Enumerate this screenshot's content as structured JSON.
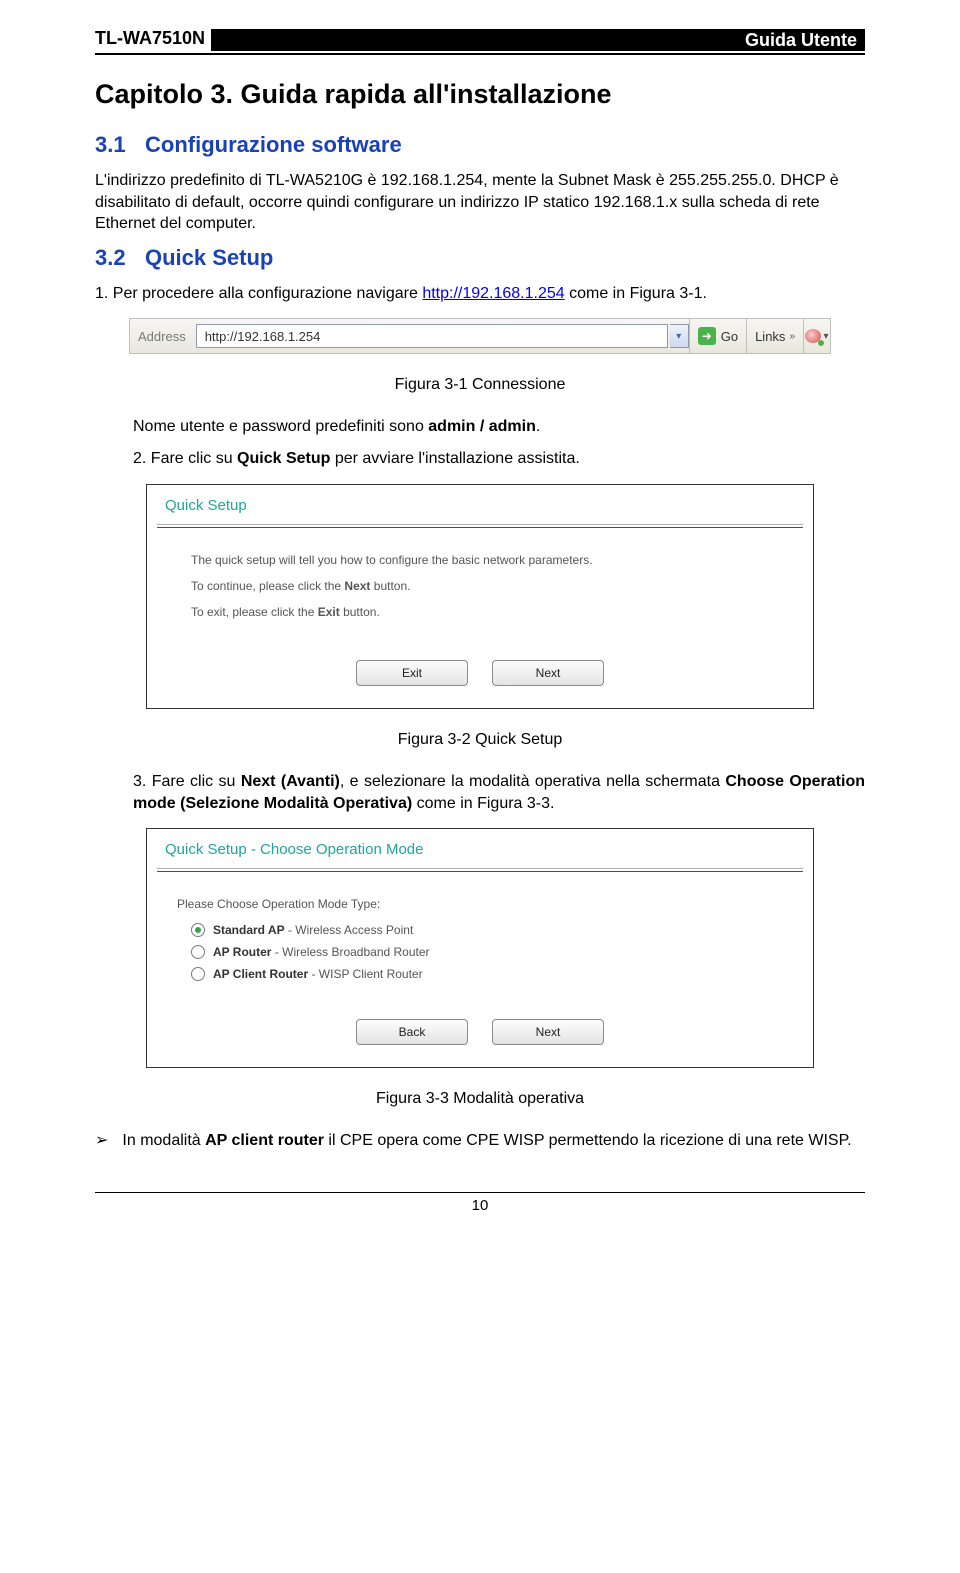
{
  "header": {
    "model": "TL-WA7510N",
    "doc_type": "Guida Utente"
  },
  "chapter": {
    "title": "Capitolo 3. Guida rapida all'installazione"
  },
  "section31": {
    "num": "3.1",
    "title": "Configurazione software",
    "para1": "L'indirizzo predefinito di TL-WA5210G è 192.168.1.254, mente la Subnet Mask è 255.255.255.0. DHCP è disabilitato di default, occorre quindi configurare un indirizzo IP statico 192.168.1.x sulla scheda di rete Ethernet del computer."
  },
  "section32": {
    "num": "3.2",
    "title": "Quick Setup",
    "step1_prefix": "1. Per procedere alla configurazione navigare ",
    "step1_link": "http://192.168.1.254",
    "step1_suffix": " come in Figura 3-1.",
    "fig1_caption": "Figura 3-1 Connessione",
    "cred_prefix": "Nome utente e password predefiniti sono ",
    "cred_value": "admin / admin",
    "cred_suffix": ".",
    "step2_prefix": "2. Fare clic su ",
    "step2_bold": "Quick Setup",
    "step2_suffix": " per avviare l'installazione assistita.",
    "fig2_caption": "Figura 3-2 Quick Setup",
    "step3_a": "3. Fare clic su ",
    "step3_b": "Next (Avanti)",
    "step3_c": ", e selezionare la modalità operativa nella schermata ",
    "step3_d": "Choose Operation mode (Selezione Modalità Operativa)",
    "step3_e": " come in Figura 3-3.",
    "fig3_caption": "Figura 3-3 Modalità operativa",
    "footer_a": "In modalità ",
    "footer_b": "AP client router",
    "footer_c": " il CPE opera come CPE WISP permettendo la ricezione di una rete WISP."
  },
  "addressbar": {
    "label": "Address",
    "url": "http://192.168.1.254",
    "go": "Go",
    "links": "Links"
  },
  "panel_qs": {
    "title": "Quick Setup",
    "line1": "The quick setup will tell you how to configure the basic network parameters.",
    "line2a": "To continue, please click the ",
    "line2b": "Next",
    "line2c": " button.",
    "line3a": "To exit, please click the ",
    "line3b": "Exit",
    "line3c": " button.",
    "btn_exit": "Exit",
    "btn_next": "Next"
  },
  "panel_mode": {
    "title": "Quick Setup - Choose Operation Mode",
    "prompt": "Please Choose Operation Mode Type:",
    "modes": [
      {
        "name": "Standard AP",
        "desc": " - Wireless Access Point",
        "checked": true
      },
      {
        "name": "AP Router",
        "desc": " - Wireless Broadband Router",
        "checked": false
      },
      {
        "name": "AP Client Router",
        "desc": " - WISP Client Router",
        "checked": false
      }
    ],
    "btn_back": "Back",
    "btn_next": "Next"
  },
  "page_number": "10"
}
